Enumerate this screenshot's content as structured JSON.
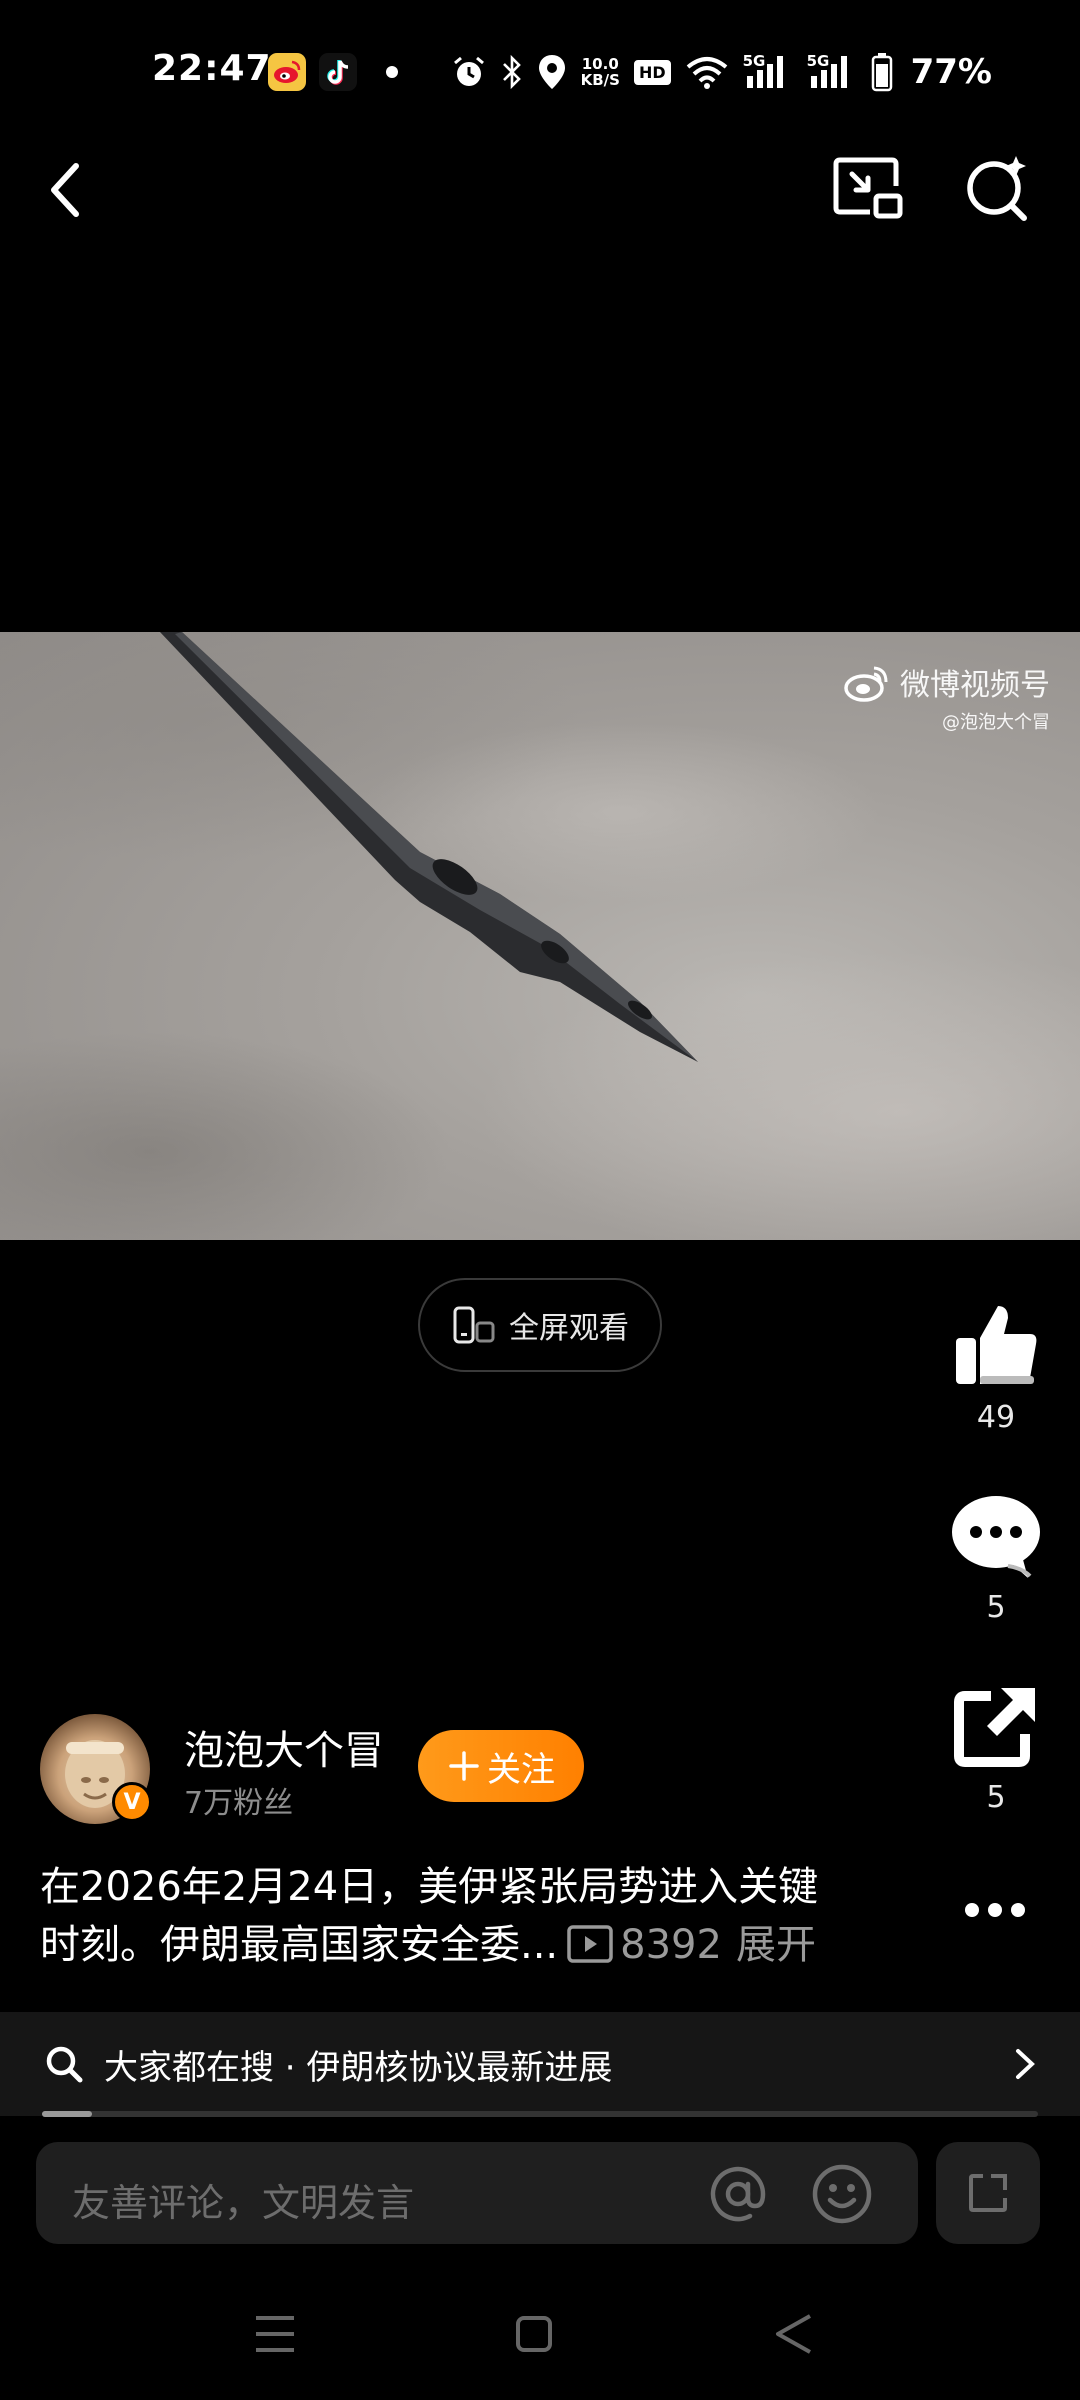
{
  "status_bar": {
    "time": "22:47",
    "net_speed_value": "10.0",
    "net_speed_unit": "KB/S",
    "hd_label": "HD",
    "signal1_label": "5G",
    "signal2_label": "5G",
    "battery": "77%",
    "icons": [
      "weibo-app-icon",
      "tiktok-app-icon",
      "notification-dot",
      "alarm-icon",
      "bluetooth-icon",
      "location-icon",
      "wifi-icon",
      "signal-icon",
      "battery-icon"
    ]
  },
  "top_bar": {
    "icons": [
      "back-icon",
      "picture-in-picture-icon",
      "search-icon"
    ]
  },
  "video": {
    "watermark_brand": "微博视频号",
    "watermark_handle": "@泡泡大个冒",
    "fullscreen_label": "全屏观看"
  },
  "actions": {
    "likes": "49",
    "comments": "5",
    "shares": "5",
    "icons": [
      "thumbs-up-icon",
      "comment-bubble-icon",
      "share-icon",
      "more-icon"
    ]
  },
  "author": {
    "name": "泡泡大个冒",
    "fans": "7万粉丝",
    "verified_badge": "V",
    "follow_label": "关注"
  },
  "description": {
    "line1": "在2026年2月24日，美伊紧张局势进入关键",
    "line2": "时刻。伊朗最高国家安全委...",
    "views": "8392",
    "expand_label": "展开"
  },
  "hot_search": {
    "text": "大家都在搜 · 伊朗核协议最新进展"
  },
  "playback": {
    "progress_fraction": 0.05
  },
  "comment_bar": {
    "placeholder": "友善评论，文明发言"
  },
  "nav_bar": {
    "icons": [
      "menu-icon",
      "home-icon",
      "back-triangle-icon"
    ]
  },
  "colors": {
    "background": "#000000",
    "accent_orange": "#ff8a00",
    "muted_text": "#8d8d8d",
    "input_background": "#1f1f1f"
  }
}
